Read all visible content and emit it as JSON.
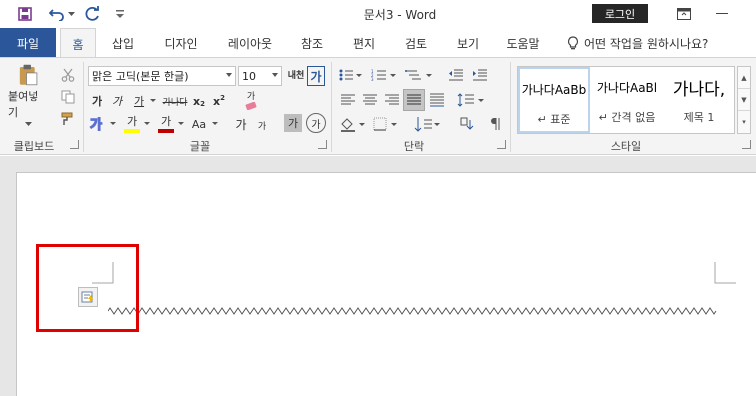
{
  "titlebar": {
    "title": "문서3  -  Word",
    "login_label": "로그인",
    "save_icon": "save-icon",
    "undo_icon": "undo-icon",
    "redo_icon": "redo-icon",
    "customize_icon": "customize-icon"
  },
  "tabs": [
    {
      "label": "파일"
    },
    {
      "label": "홈"
    },
    {
      "label": "삽입"
    },
    {
      "label": "디자인"
    },
    {
      "label": "레이아웃"
    },
    {
      "label": "참조"
    },
    {
      "label": "편지"
    },
    {
      "label": "검토"
    },
    {
      "label": "보기"
    },
    {
      "label": "도움말"
    }
  ],
  "tell_me": "어떤 작업을 원하시나요?",
  "clipboard": {
    "paste_label": "붙여넣기",
    "group_label": "클립보드"
  },
  "font": {
    "font_name": "맑은 고딕(본문 한글)",
    "font_size": "10",
    "group_label": "글꼴",
    "ruby_label": "내천",
    "border_label": "가",
    "bold": "가",
    "italic": "가",
    "underline": "가",
    "strike": "가나다",
    "subscript": "x",
    "superscript": "x",
    "clear_format": "가",
    "highlight": "가",
    "font_color": "가",
    "change_case": "Aa",
    "grow": "가",
    "shrink": "가",
    "char_shade": "가",
    "enclose": "가"
  },
  "paragraph": {
    "group_label": "단락"
  },
  "styles": {
    "group_label": "스타일",
    "items": [
      {
        "sample": "가나다AaBb",
        "name": "↵ 표준"
      },
      {
        "sample": "가나다AaBl",
        "name": "↵ 간격 없음"
      },
      {
        "sample": "가나다,",
        "name": "제목 1"
      }
    ]
  },
  "colors": {
    "word_blue": "#2b579a",
    "highlight_yellow": "#ffff00",
    "font_red": "#c00000",
    "callout_red": "#e00000"
  }
}
